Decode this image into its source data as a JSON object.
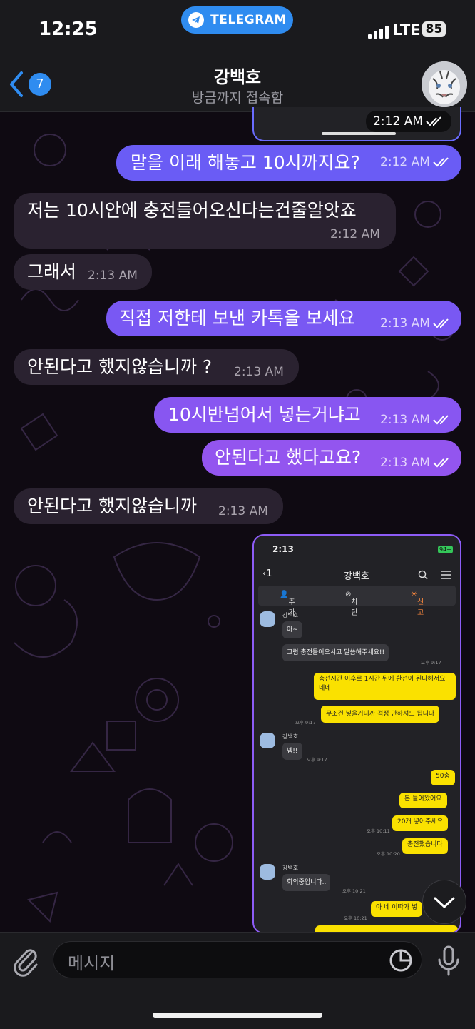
{
  "status_bar": {
    "time": "12:25",
    "app_pill": "TELEGRAM",
    "network": "LTE",
    "battery": "85"
  },
  "header": {
    "back_count": "7",
    "title": "강백호",
    "subtitle": "방금까지 접속함"
  },
  "top_card": {
    "time": "2:12 AM"
  },
  "messages": [
    {
      "text": "말을 이래 해놓고 10시까지요?",
      "time": "2:12 AM",
      "direction": "out"
    },
    {
      "text": "저는 10시안에 충전들어오신다는건줄알앗죠",
      "time": "2:12 AM",
      "direction": "in"
    },
    {
      "text": "그래서",
      "time": "2:13 AM",
      "direction": "in"
    },
    {
      "text": "직접 저한테 보낸 카톡을 보세요",
      "time": "2:13 AM",
      "direction": "out"
    },
    {
      "text": "안된다고 했지않습니까 ?",
      "time": "2:13 AM",
      "direction": "in"
    },
    {
      "text": "10시반넘어서 넣는거냐고",
      "time": "2:13 AM",
      "direction": "out"
    },
    {
      "text": "안된다고 했다고요?",
      "time": "2:13 AM",
      "direction": "out"
    },
    {
      "text": "안된다고 했지않습니까",
      "time": "2:13 AM",
      "direction": "in"
    }
  ],
  "embedded_screenshot": {
    "time": "2:13",
    "battery": "94+",
    "back": "1",
    "title": "강백호",
    "actions": [
      "추가",
      "차단",
      "신고"
    ],
    "sender": "강백호",
    "chat": [
      {
        "dir": "in",
        "text": "아~"
      },
      {
        "dir": "in",
        "text": "그럼 충전들어오시고 말씀해주세요!!",
        "time": "오후 9:17"
      },
      {
        "dir": "out",
        "text": "충전시간 이후로 1시간 뒤에 환전이 된다해서요 네네"
      },
      {
        "dir": "out",
        "text": "무조건 넣을거니까 걱정 안하셔도 됩니다",
        "time": "오후 9:17"
      },
      {
        "dir": "in",
        "text": "넵!!",
        "time": "오후 9:17"
      },
      {
        "dir": "out",
        "text": "50충"
      },
      {
        "dir": "out",
        "text": "돈 들어왔어요"
      },
      {
        "dir": "out",
        "text": "20개 넣어주세요",
        "time": "오후 10:11"
      },
      {
        "dir": "out",
        "text": "충전했습니다",
        "time": "오후 10:20"
      },
      {
        "dir": "in",
        "text": "회의중입니다..",
        "time": "오후 10:21"
      },
      {
        "dir": "out",
        "text": "아 네 이따가 넣",
        "time": "오후 10:21"
      }
    ]
  },
  "input": {
    "placeholder": "메시지"
  },
  "colors": {
    "accent": "#2f8cf0",
    "bubble_out_top": "#6a5cf5",
    "bubble_out_bottom": "#9b55ef",
    "bubble_in": "#2a2230",
    "kakao_yellow": "#fae100"
  },
  "icons": [
    "telegram-plane-icon",
    "signal-icon",
    "back-chevron-icon",
    "read-ticks-icon",
    "scroll-down-icon",
    "attach-icon",
    "sticker-icon",
    "mic-icon"
  ]
}
